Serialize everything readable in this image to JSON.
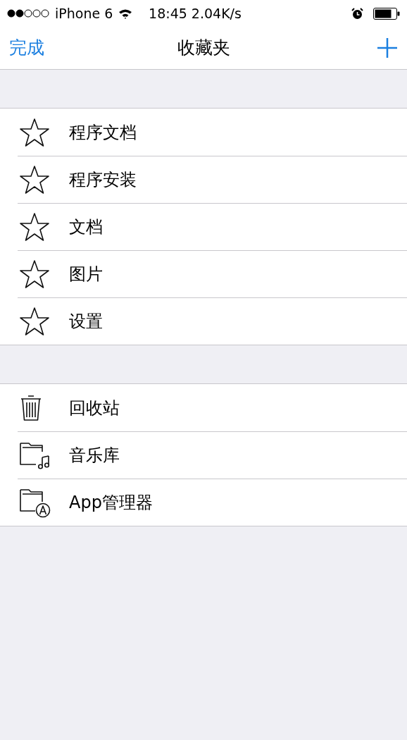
{
  "status_bar": {
    "carrier": "iPhone 6",
    "time": "18:45 2.04K/s"
  },
  "nav_bar": {
    "left_button": "完成",
    "title": "收藏夹"
  },
  "sections": [
    {
      "items": [
        {
          "kind": "star",
          "label": "程序文档"
        },
        {
          "kind": "star",
          "label": "程序安装"
        },
        {
          "kind": "star",
          "label": "文档"
        },
        {
          "kind": "star",
          "label": "图片"
        },
        {
          "kind": "star",
          "label": "设置"
        }
      ]
    },
    {
      "items": [
        {
          "kind": "trash",
          "label": "回收站"
        },
        {
          "kind": "music_folder",
          "label": "音乐库"
        },
        {
          "kind": "app_folder",
          "label": "App管理器"
        }
      ]
    }
  ]
}
